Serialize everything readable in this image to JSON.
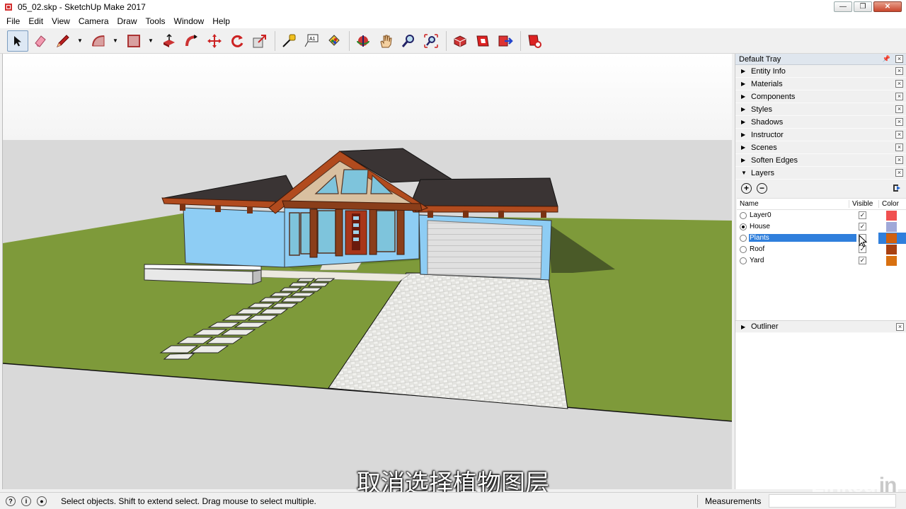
{
  "window": {
    "title": "05_02.skp - SketchUp Make 2017",
    "minimize": "—",
    "restore": "❐",
    "close": "✕"
  },
  "menu": {
    "items": [
      "File",
      "Edit",
      "View",
      "Camera",
      "Draw",
      "Tools",
      "Window",
      "Help"
    ]
  },
  "toolbar": {
    "tools": [
      "select",
      "eraser",
      "line",
      "arc",
      "shape",
      "push-pull",
      "follow-me",
      "move",
      "rotate",
      "scale",
      "tape-measure",
      "text",
      "paint-bucket",
      "orbit",
      "pan",
      "zoom",
      "zoom-extents",
      "3d-warehouse",
      "extension-warehouse",
      "layout",
      "extension-manager"
    ]
  },
  "tray": {
    "title": "Default Tray",
    "panels": [
      "Entity Info",
      "Materials",
      "Components",
      "Styles",
      "Shadows",
      "Instructor",
      "Scenes",
      "Soften Edges"
    ],
    "layers_panel": "Layers",
    "layers_columns": {
      "name": "Name",
      "visible": "Visible",
      "color": "Color"
    },
    "layers": [
      {
        "name": "Layer0",
        "active": false,
        "visible": true,
        "color": "#f05050"
      },
      {
        "name": "House",
        "active": true,
        "visible": true,
        "color": "#a0a8d8"
      },
      {
        "name": "Plants",
        "active": false,
        "visible": false,
        "color": "#d06010",
        "selected": true
      },
      {
        "name": "Roof",
        "active": false,
        "visible": true,
        "color": "#a84010"
      },
      {
        "name": "Yard",
        "active": false,
        "visible": true,
        "color": "#d87010"
      }
    ],
    "outliner": "Outliner"
  },
  "status": {
    "message": "Select objects. Shift to extend select. Drag mouse to select multiple.",
    "measurements_label": "Measurements"
  },
  "subtitle": "取消选择植物图层",
  "watermark": {
    "linked": "Linked",
    "in": "in"
  },
  "colors": {
    "sky": "#ffffff",
    "ground": "#d8d8d8",
    "grass": "#7e9a3a",
    "walls": "#8ecdf4",
    "roof": "#3a3434",
    "trim": "#b14b1e",
    "selection": "#2f7fdc"
  }
}
